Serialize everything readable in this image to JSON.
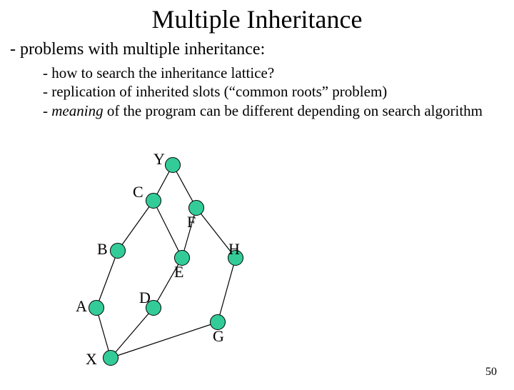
{
  "title": "Multiple Inheritance",
  "mainBullet": "- problems with multiple inheritance:",
  "sub1": "- how to search the inheritance lattice?",
  "sub2": "- replication of inherited slots (“common roots” problem)",
  "sub3_pre": "- ",
  "sub3_em": "meaning",
  "sub3_post": " of the program can be different depending on search algorithm",
  "labels": {
    "Y": "Y",
    "C": "C",
    "F": "F",
    "B": "B",
    "E": "E",
    "H": "H",
    "A": "A",
    "D": "D",
    "G": "G",
    "X": "X"
  },
  "pageNumber": "50"
}
